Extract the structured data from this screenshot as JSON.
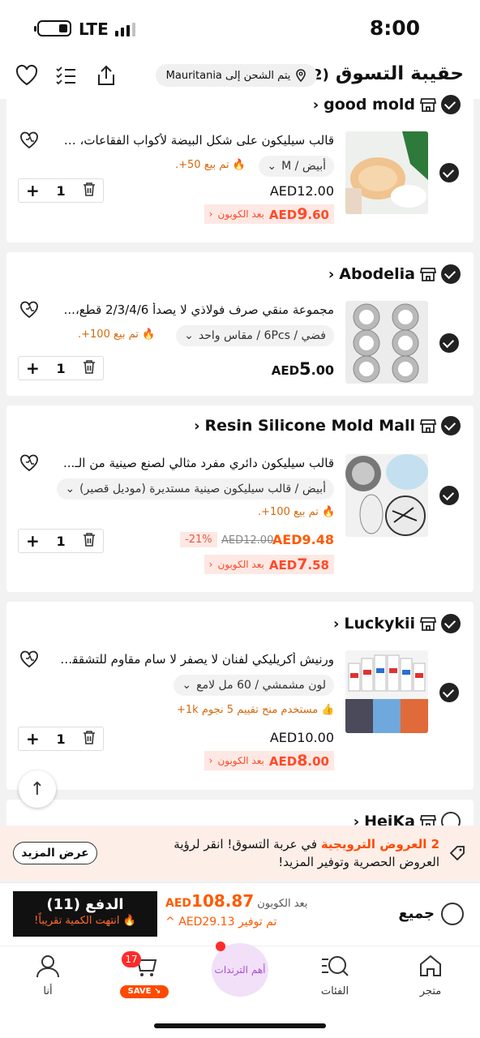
{
  "status_bar": {
    "time": "8:00",
    "network": "LTE"
  },
  "header": {
    "title": "حقيبة التسوق",
    "count": "(12)",
    "ship_to": "يتم الشحن إلى Mauritania"
  },
  "stores": [
    {
      "name": "good mold",
      "items": [
        {
          "title": "قالب سيليكون على شكل البيضة لأكواب الفقاعات، صـ...",
          "variant": "أبيض / M",
          "sold": "تم بيع 50+.",
          "price": "AED12.00",
          "coupon_price_currency": "AED",
          "coupon_price_int": "9",
          "coupon_price_dec": ".60",
          "coupon_label": "بعد الكوبون",
          "qty": "1"
        }
      ]
    },
    {
      "name": "Abodelia",
      "items": [
        {
          "title": "مجموعة منقي صرف فولاذي لا يصدأ 2/3/4/6 قطع،...",
          "variant": "فضي / 6Pcs / مقاس واحد",
          "sold": "تم بيع 100+.",
          "price_currency": "AED",
          "price_int": "5",
          "price_dec": ".00",
          "qty": "1"
        }
      ]
    },
    {
      "name": "Resin Silicone Mold Mall",
      "items": [
        {
          "title": "قالب سيليكون دائري مفرد مثالي لصنع صينية من الـ...",
          "variant": "أبيض / قالب سيليكون صينية مستديرة (موديل قصير)",
          "sold": "تم بيع 100+.",
          "price": "AED9.48",
          "original_price": "AED12.00",
          "discount": "-21%",
          "coupon_price_currency": "AED",
          "coupon_price_int": "7",
          "coupon_price_dec": ".58",
          "coupon_label": "بعد الكوبون",
          "qty": "1"
        }
      ]
    },
    {
      "name": "Luckykii",
      "items": [
        {
          "title": "ورنيش أكريليكي لفنان لا يصفر لا سامٍ مقاوم للتشققا...",
          "variant": "لون مشمشي / 60 مل لامع",
          "sold": "مستخدم منح تقييم 5 نجوم 1k+",
          "price": "AED10.00",
          "coupon_price_currency": "AED",
          "coupon_price_int": "8",
          "coupon_price_dec": ".00",
          "coupon_label": "بعد الكوبون",
          "qty": "1"
        }
      ]
    },
    {
      "name": "HeiKa"
    }
  ],
  "promo": {
    "highlight": "2 العروض الترويجية",
    "text": " في عربة التسوق! انقر لرؤية العروض الحصرية وتوفير المزيد!",
    "button": "عرض المزيد"
  },
  "checkout": {
    "select_all": "جميع",
    "after_coupon_label": "بعد الكوبون",
    "total_currency": "AED",
    "total": "108.87",
    "saving": "تم توفير AED29.13",
    "pay_label": "الدفع (11)",
    "pay_sub": "انتهت الكمية تقريباً!"
  },
  "nav": {
    "home": "متجر",
    "categories": "الفئات",
    "trends": "أهم الترندات",
    "cart_badge": "17",
    "cart_save": "SAVE",
    "me": "أنا"
  },
  "colors": {
    "accent": "#ff5a00",
    "coupon_bg": "#fde8e3",
    "promo_bg": "#fdeee8",
    "trend_bg": "#f2dff8"
  }
}
